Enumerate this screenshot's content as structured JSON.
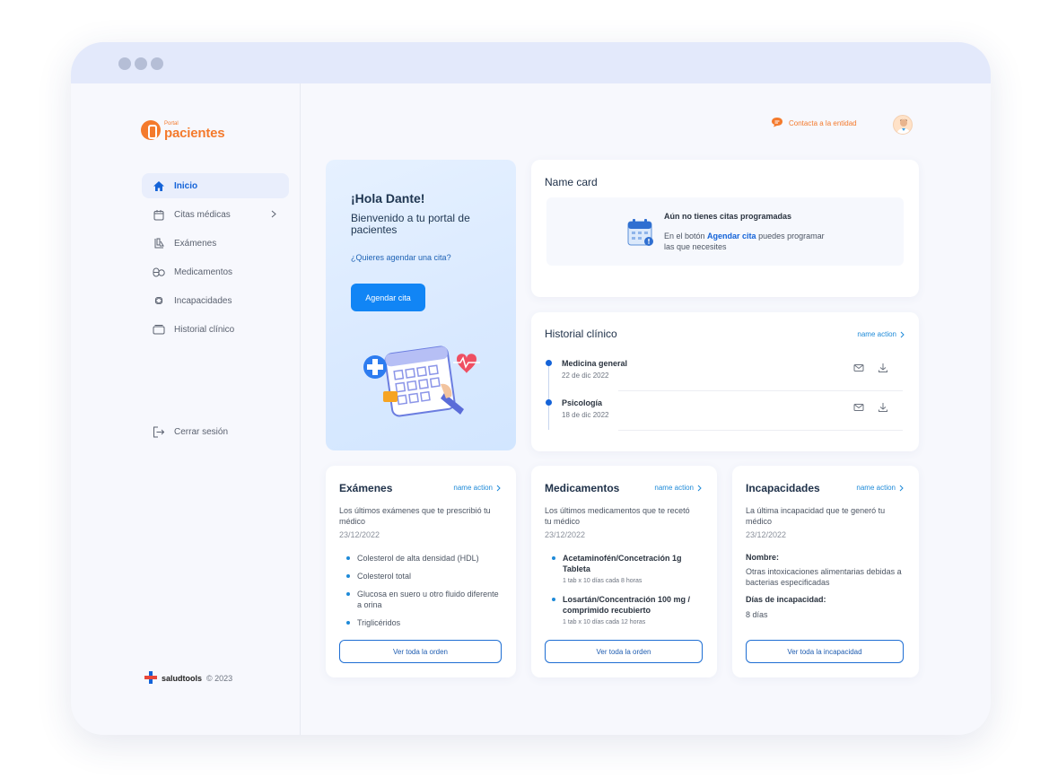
{
  "brand": {
    "small": "Portal",
    "big": "pacientes"
  },
  "nav": {
    "items": [
      {
        "label": "Inicio"
      },
      {
        "label": "Citas médicas"
      },
      {
        "label": "Exámenes"
      },
      {
        "label": "Medicamentos"
      },
      {
        "label": "Incapacidades"
      },
      {
        "label": "Historial clínico"
      }
    ],
    "logout": "Cerrar sesión"
  },
  "footer": {
    "brand": "saludtools",
    "copyright": "© 2023"
  },
  "header": {
    "contact": "Contacta a la entidad"
  },
  "hero": {
    "greeting": "¡Hola Dante!",
    "subtitle": "Bienvenido a tu portal de pacientes",
    "question": "¿Quieres agendar una cita?",
    "button": "Agendar cita"
  },
  "name_card": {
    "title": "Name card",
    "empty_title": "Aún no tienes citas programadas",
    "empty_text_pre": "En el botón ",
    "empty_text_link": "Agendar cita",
    "empty_text_post": " puedes programar las que necesites"
  },
  "history": {
    "title": "Historial clínico",
    "action": "name action",
    "rows": [
      {
        "name": "Medicina general",
        "date": "22 de dic 2022"
      },
      {
        "name": "Psicología",
        "date": "18 de dic 2022"
      }
    ]
  },
  "exams": {
    "title": "Exámenes",
    "action": "name action",
    "desc": "Los últimos exámenes que te prescribió tu médico",
    "date": "23/12/2022",
    "items": [
      "Colesterol de alta densidad (HDL)",
      "Colesterol total",
      "Glucosa en suero u otro fluido diferente a orina",
      "Triglicéridos"
    ],
    "button": "Ver toda la orden"
  },
  "meds": {
    "title": "Medicamentos",
    "action": "name action",
    "desc": "Los últimos medicamentos que te recetó tu médico",
    "date": "23/12/2022",
    "items": [
      {
        "name": "Acetaminofén/Concetración 1g Tableta",
        "dose": "1 tab x 10 días cada 8 horas"
      },
      {
        "name": "Losartán/Concentración 100 mg / comprimido recubierto",
        "dose": "1 tab x 10 días cada 12 horas"
      }
    ],
    "button": "Ver toda la orden"
  },
  "disability": {
    "title": "Incapacidades",
    "action": "name action",
    "desc": "La última incapacidad que te generó tu médico",
    "date": "23/12/2022",
    "name_label": "Nombre:",
    "name_value": "Otras intoxicaciones alimentarias debidas a bacterias especificadas",
    "days_label": "Días de incapacidad:",
    "days_value": "8 días",
    "button": "Ver toda la incapacidad"
  },
  "colors": {
    "primary": "#1185f5",
    "brand": "#f47a2c",
    "accent": "#1463d8"
  }
}
